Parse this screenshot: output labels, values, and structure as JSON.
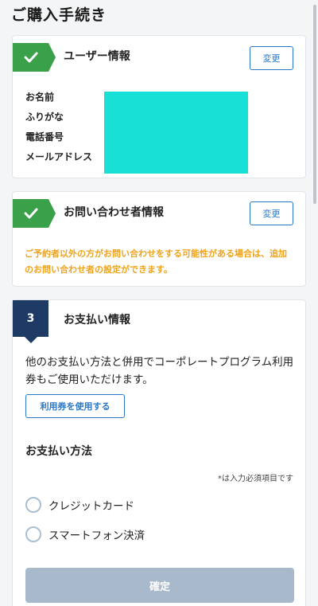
{
  "page": {
    "title": "ご購入手続き"
  },
  "user_section": {
    "title": "ユーザー情報",
    "change_label": "変更",
    "fields": [
      "お名前",
      "ふりがな",
      "電話番号",
      "メールアドレス"
    ]
  },
  "contact_section": {
    "title": "お問い合わせ者情報",
    "change_label": "変更",
    "notice": "ご予約者以外の方がお問い合わせをする可能性がある場合は、追加のお問い合わせ者の設定ができます。"
  },
  "payment_section": {
    "step": "3",
    "title": "お支払い情報",
    "description": "他のお支払い方法と併用でコーポレートプログラム利用券もご使用いただけます。",
    "coupon_button": "利用券を使用する",
    "method_title": "お支払い方法",
    "required_note": "*は入力必須項目です",
    "options": [
      "クレジットカード",
      "スマートフォン決済"
    ],
    "confirm_button": "確定"
  },
  "colors": {
    "check_green": "#3aa04a",
    "step_navy": "#1d3b64",
    "link_blue": "#2a78c8",
    "notice_orange": "#f0a31c",
    "redaction": "#19e0d6",
    "disabled_button": "#a8b9cc"
  }
}
